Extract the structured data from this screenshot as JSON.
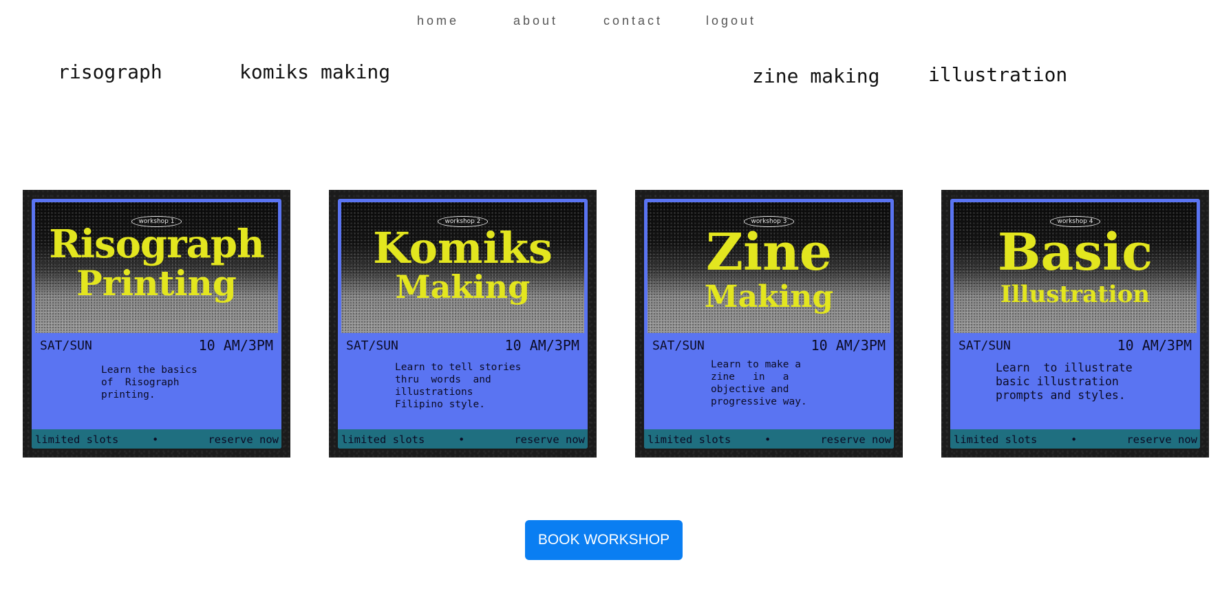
{
  "nav": {
    "home": "home",
    "about": "about",
    "contact": "contact",
    "logout": "logout"
  },
  "categories": [
    "risograph",
    "komiks making",
    "zine making",
    "illustration"
  ],
  "workshops": [
    {
      "badge": "workshop 1",
      "title_line1": "Risograph",
      "title_line2": "Printing",
      "days": "SAT/SUN",
      "time": "10 AM/3PM",
      "description": "Learn the basics\nof  Risograph\nprinting.",
      "footer_left": "limited slots",
      "footer_dot": "•",
      "footer_right": "reserve now"
    },
    {
      "badge": "workshop 2",
      "title_line1": "Komiks",
      "title_line2": "Making",
      "days": "SAT/SUN",
      "time": "10 AM/3PM",
      "description": "Learn to tell stories\nthru  words  and\nillustrations\nFilipino style.",
      "footer_left": "limited slots",
      "footer_dot": "•",
      "footer_right": "reserve now"
    },
    {
      "badge": "workshop 3",
      "title_line1": "Zine",
      "title_line2": "Making",
      "days": "SAT/SUN",
      "time": "10 AM/3PM",
      "description": "Learn to make a\nzine   in   a\nobjective and\nprogressive way.",
      "footer_left": "limited slots",
      "footer_dot": "•",
      "footer_right": "reserve now"
    },
    {
      "badge": "workshop 4",
      "title_line1": "Basic",
      "title_line2": "Illustration",
      "days": "SAT/SUN",
      "time": "10 AM/3PM",
      "description": "Learn  to illustrate\nbasic illustration\nprompts and styles.",
      "footer_left": "limited slots",
      "footer_dot": "•",
      "footer_right": "reserve now"
    }
  ],
  "book_button": "BOOK WORKSHOP",
  "colors": {
    "poster_frame": "#5a74f2",
    "title_yellow": "#e3e61f",
    "footer_teal": "#1f6f80",
    "button_blue": "#0a7ef2"
  }
}
